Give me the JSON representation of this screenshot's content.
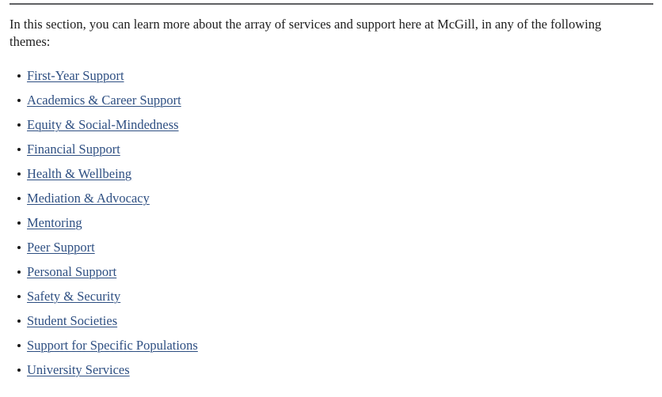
{
  "divider": {
    "name": "section-divider",
    "color": "#5f6063"
  },
  "intro": {
    "text": "In this section, you can learn more about the array of services and support here at McGill, in any of the following themes:"
  },
  "theme_list": {
    "link_color": "#2e4f82",
    "bullet_color": "#1a1a1a",
    "items": [
      {
        "label": "First-Year Support"
      },
      {
        "label": "Academics & Career Support"
      },
      {
        "label": "Equity & Social-Mindedness"
      },
      {
        "label": "Financial Support"
      },
      {
        "label": "Health & Wellbeing"
      },
      {
        "label": "Mediation & Advocacy"
      },
      {
        "label": "Mentoring"
      },
      {
        "label": "Peer Support"
      },
      {
        "label": "Personal Support"
      },
      {
        "label": "Safety & Security"
      },
      {
        "label": "Student Societies"
      },
      {
        "label": "Support for Specific Populations"
      },
      {
        "label": "University Services"
      }
    ]
  }
}
